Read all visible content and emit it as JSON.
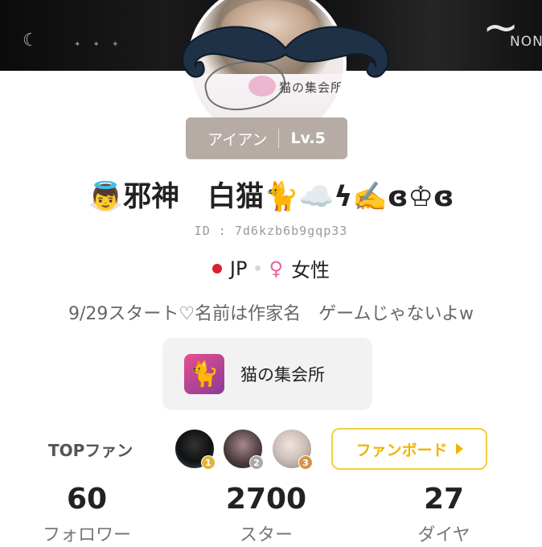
{
  "header": {
    "banner_text": "NON"
  },
  "avatar": {
    "caption": "猫の集会所"
  },
  "rank": {
    "tier": "アイアン",
    "level": "Lv.5"
  },
  "profile": {
    "username": "👼邪神　白猫🐈☁️ϟ✍️ɞ♔ɞ",
    "id": "ID : 7d6kzb6b9gqp33",
    "country": "JP",
    "gender": "女性",
    "gender_icon": "♀",
    "bio": "9/29スタート♡名前は作家名　ゲームじゃないよw"
  },
  "community": {
    "name": "猫の集会所",
    "icon": "cat-icon"
  },
  "topfans": {
    "label": "TOPファン",
    "ranks": [
      "1",
      "2",
      "3"
    ],
    "fanboard_label": "ファンボード"
  },
  "stats": {
    "followers": {
      "value": "60",
      "label": "フォロワー"
    },
    "stars": {
      "value": "2700",
      "label": "スター"
    },
    "diamonds": {
      "value": "27",
      "label": "ダイヤ"
    }
  },
  "colors": {
    "rank_badge_bg": "#b7aca5",
    "fanboard_accent": "#f0b400",
    "country_dot": "#d6232e",
    "gender": "#e9639c"
  }
}
